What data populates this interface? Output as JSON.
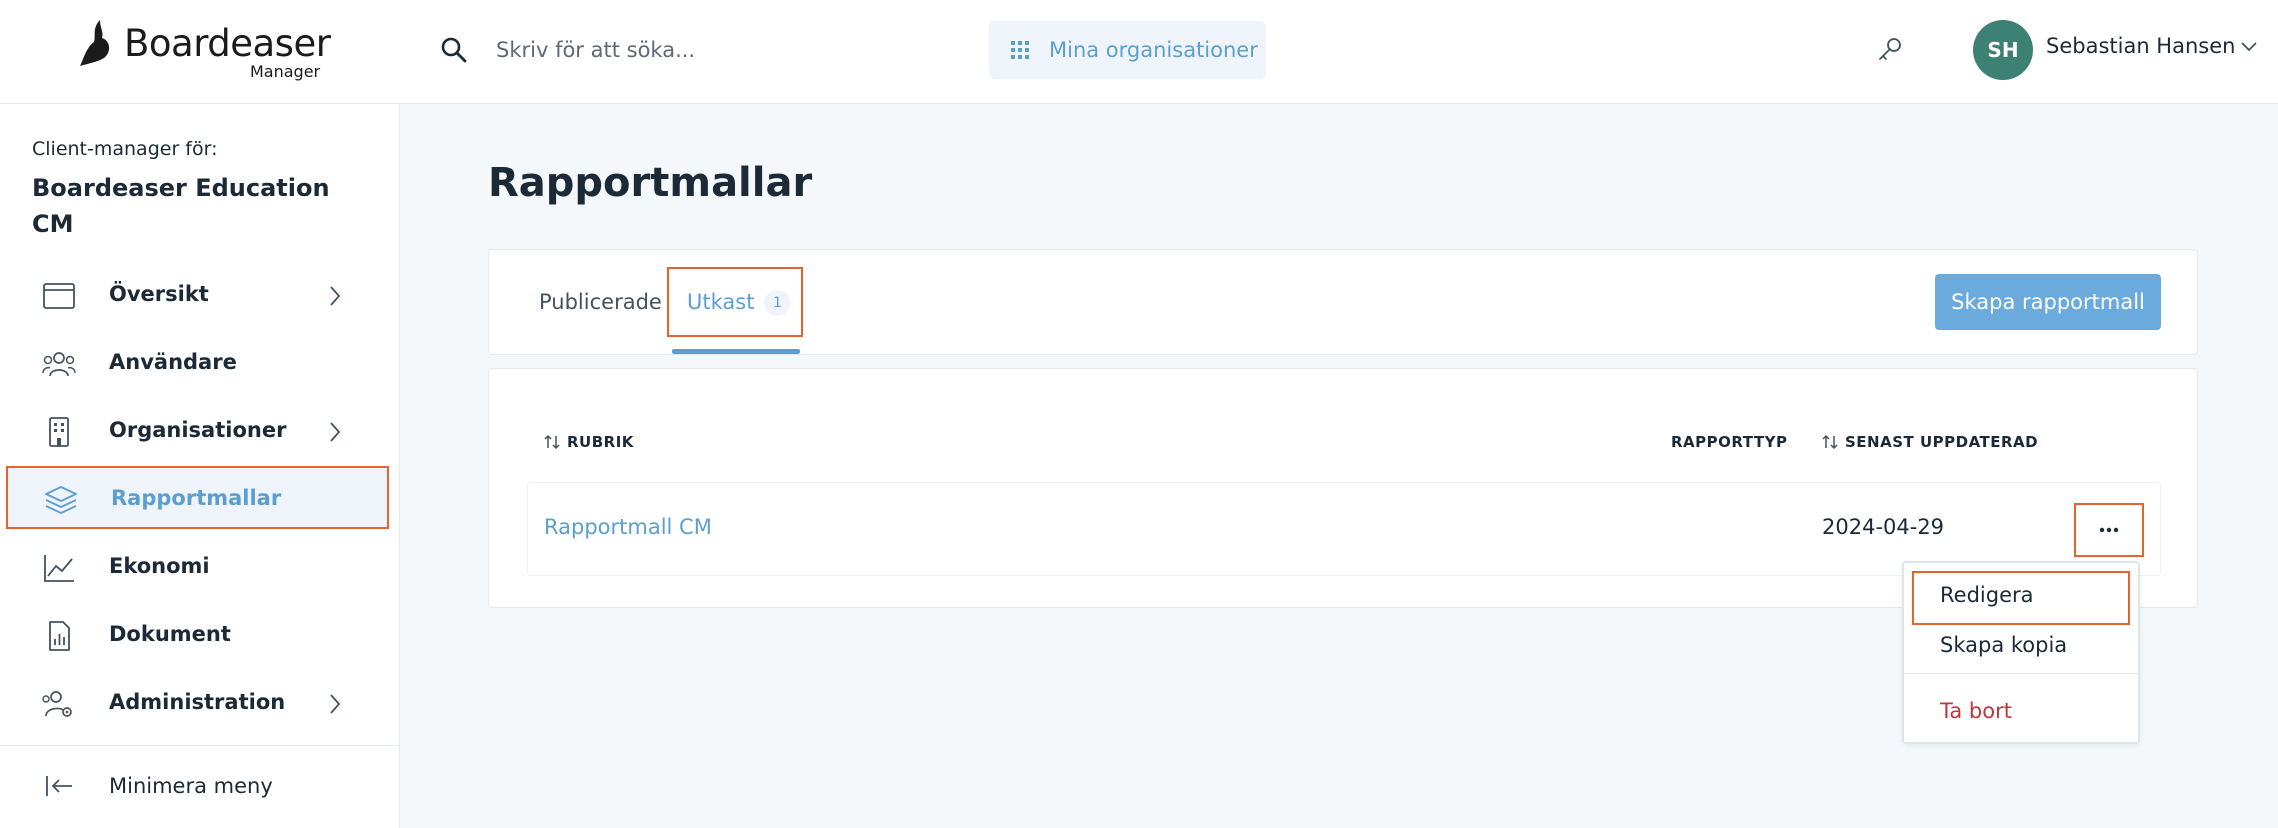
{
  "header": {
    "logo_name": "Boardeaser",
    "logo_sub": "Manager",
    "search_placeholder": "Skriv för att söka...",
    "org_button_label": "Mina organisationer",
    "user_initials": "SH",
    "user_name": "Sebastian Hansen"
  },
  "sidebar": {
    "client_manager_label": "Client-manager för:",
    "client_manager_name": "Boardeaser Education CM",
    "items": [
      {
        "label": "Översikt",
        "icon": "window-icon",
        "has_chevron": true
      },
      {
        "label": "Användare",
        "icon": "users-icon",
        "has_chevron": false
      },
      {
        "label": "Organisationer",
        "icon": "building-icon",
        "has_chevron": true
      },
      {
        "label": "Rapportmallar",
        "icon": "layers-icon",
        "has_chevron": false,
        "active": true
      },
      {
        "label": "Ekonomi",
        "icon": "line-chart-icon",
        "has_chevron": false
      },
      {
        "label": "Dokument",
        "icon": "document-chart-icon",
        "has_chevron": false
      },
      {
        "label": "Administration",
        "icon": "users-gear-icon",
        "has_chevron": true
      }
    ],
    "minimize_label": "Minimera meny"
  },
  "main": {
    "title": "Rapportmallar",
    "tabs": [
      {
        "label": "Publicerade"
      },
      {
        "label": "Utkast",
        "count": "1",
        "active": true
      }
    ],
    "create_button_label": "Skapa rapportmall",
    "table": {
      "columns": [
        "RUBRIK",
        "RAPPORTTYP",
        "SENAST UPPDATERAD"
      ],
      "rows": [
        {
          "title": "Rapportmall CM",
          "type": "",
          "updated": "2024-04-29"
        }
      ]
    },
    "row_menu": {
      "items": [
        "Redigera",
        "Skapa kopia",
        "Ta bort"
      ]
    }
  },
  "colors": {
    "accent": "#5b9fd0",
    "button": "#6aaadc",
    "highlight_border": "#e8622d",
    "danger": "#c3343d",
    "avatar": "#3d8174"
  }
}
